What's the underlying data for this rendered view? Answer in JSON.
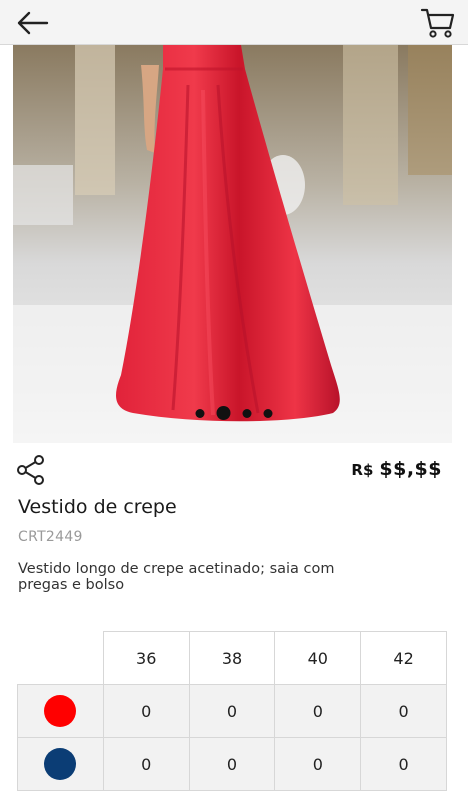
{
  "icons": {
    "back": "arrow-left-icon",
    "cart": "shopping-cart-icon",
    "share": "share-icon"
  },
  "gallery": {
    "image": "red-satin-long-dress-photo",
    "dots": 4,
    "active_dot": 2
  },
  "product": {
    "currency": "R$",
    "price": "$$,$$",
    "name": "Vestido de crepe",
    "code": "CRT2449",
    "description": "Vestido longo de crepe acetinado; saia com pregas e bolso"
  },
  "grid": {
    "sizes": [
      "36",
      "38",
      "40",
      "42"
    ],
    "rows": [
      {
        "color": "#ff0000",
        "quantities": [
          "0",
          "0",
          "0",
          "0"
        ]
      },
      {
        "color": "#0b3d75",
        "quantities": [
          "0",
          "0",
          "0",
          "0"
        ]
      }
    ]
  }
}
